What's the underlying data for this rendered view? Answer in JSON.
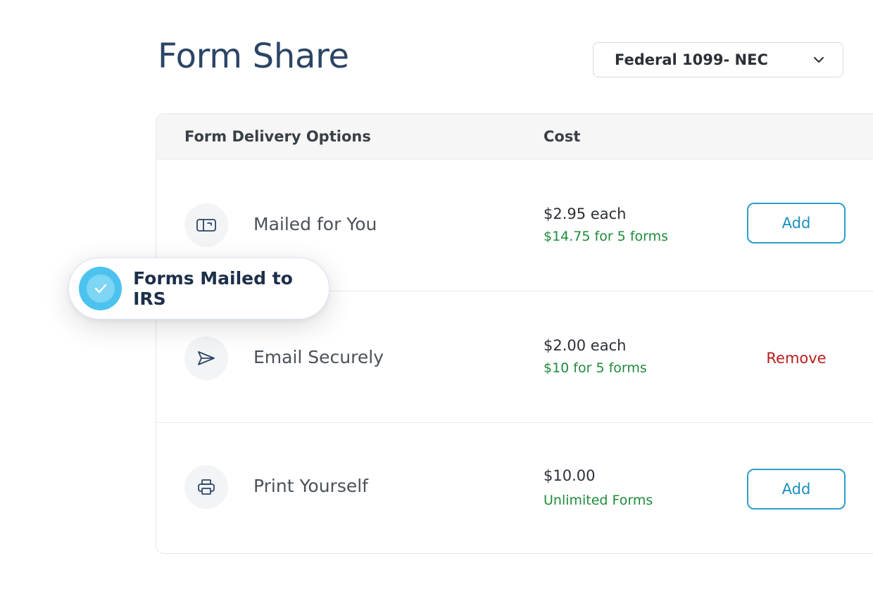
{
  "page": {
    "title": "Form Share"
  },
  "form_select": {
    "value": "Federal 1099- NEC",
    "icon": "chevron-down-icon"
  },
  "table": {
    "headers": {
      "options": "Form Delivery Options",
      "cost": "Cost"
    },
    "rows": [
      {
        "icon": "mailbox-icon",
        "label": "Mailed for You",
        "price": "$2.95 each",
        "price_detail": "$14.75 for 5 forms",
        "action": "Add",
        "action_type": "add"
      },
      {
        "icon": "send-icon",
        "label": "Email Securely",
        "price": "$2.00 each",
        "price_detail": "$10 for 5 forms",
        "action": "Remove",
        "action_type": "remove"
      },
      {
        "icon": "printer-icon",
        "label": "Print Yourself",
        "price": "$10.00",
        "price_detail": "Unlimited Forms",
        "action": "Add",
        "action_type": "add"
      }
    ]
  },
  "toast": {
    "label": "Forms Mailed to IRS",
    "icon": "check-icon"
  },
  "colors": {
    "title": "#2c4566",
    "accent": "#2aa0c9",
    "price_detail": "#1f8a3b",
    "remove": "#b91c1c",
    "check_badge": "#4cc3ef"
  }
}
